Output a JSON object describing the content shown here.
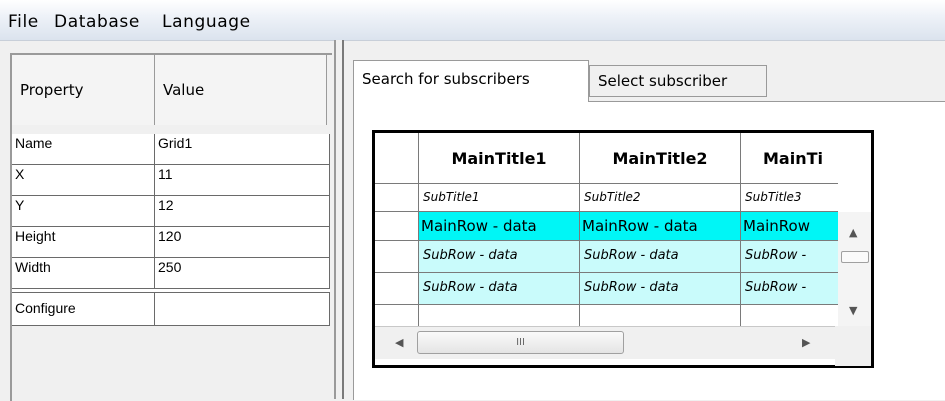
{
  "menu": {
    "file": "File",
    "database": "Database",
    "language": "Language"
  },
  "properties": {
    "header": {
      "property": "Property",
      "value": "Value"
    },
    "rows": [
      {
        "name": "Name",
        "value": "Grid1"
      },
      {
        "name": "X",
        "value": "11"
      },
      {
        "name": "Y",
        "value": "12"
      },
      {
        "name": "Height",
        "value": "120"
      },
      {
        "name": "Width",
        "value": "250"
      }
    ],
    "configure": "Configure"
  },
  "tabs": [
    {
      "label": "Search for subscribers"
    },
    {
      "label": "Select subscriber"
    }
  ],
  "grid": {
    "main_titles": [
      "MainTitle1",
      "MainTitle2",
      "MainTi"
    ],
    "sub_titles": [
      "SubTitle1",
      "SubTitle2",
      "SubTitle3"
    ],
    "main_row": [
      "MainRow - data",
      "MainRow - data",
      "MainRow"
    ],
    "sub_rows": [
      [
        "SubRow - data",
        "SubRow - data",
        "SubRow -"
      ],
      [
        "SubRow - data",
        "SubRow - data",
        "SubRow -"
      ]
    ],
    "hscroll_grip": "III"
  },
  "colors": {
    "main_row_bg": "#00f6f6",
    "sub_row_bg": "#c9fbfb"
  }
}
